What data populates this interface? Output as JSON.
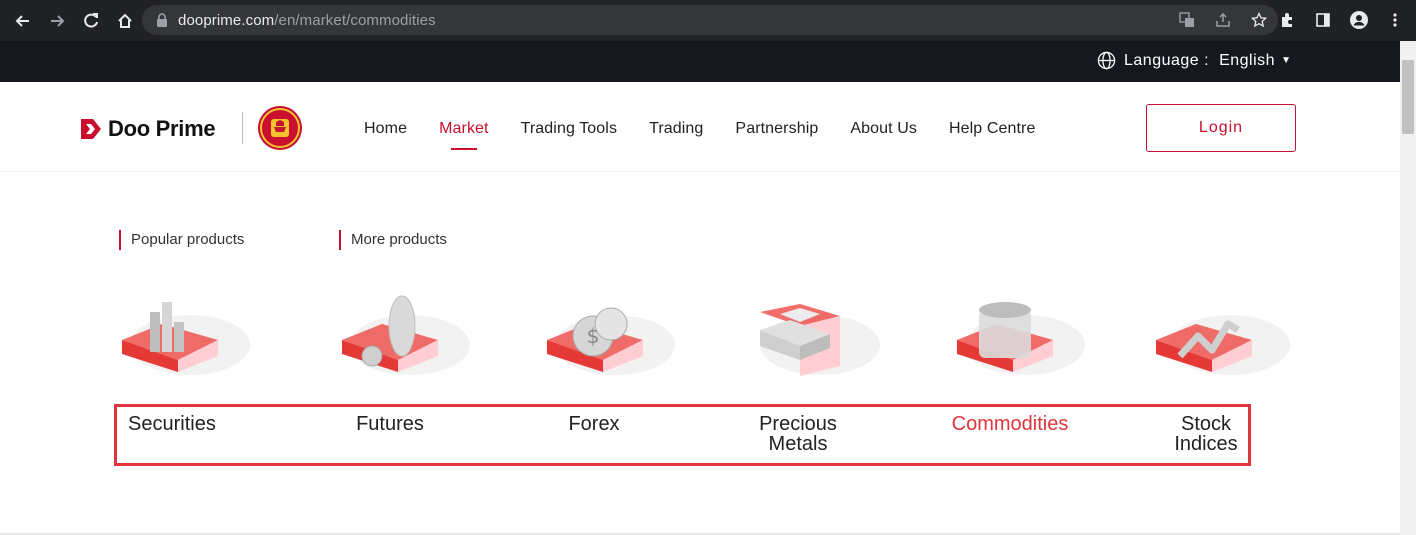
{
  "browser": {
    "url_host": "dooprime.com",
    "url_path": "/en/market/commodities"
  },
  "topbar": {
    "language_label": "Language :",
    "language_value": "English"
  },
  "header": {
    "brand": "Doo Prime",
    "menu": [
      "Home",
      "Market",
      "Trading Tools",
      "Trading",
      "Partnership",
      "About Us",
      "Help Centre"
    ],
    "active_menu": "Market",
    "login_label": "Login"
  },
  "product_tabs": {
    "popular": "Popular products",
    "more": "More products"
  },
  "products": [
    {
      "label": "Securities",
      "icon": "securities-icon"
    },
    {
      "label": "Futures",
      "icon": "futures-icon"
    },
    {
      "label": "Forex",
      "icon": "forex-icon"
    },
    {
      "label_line1": "Precious",
      "label_line2": "Metals",
      "icon": "precious-metals-icon"
    },
    {
      "label": "Commodities",
      "icon": "commodities-icon",
      "active": true
    },
    {
      "label_line1": "Stock",
      "label_line2": "Indices",
      "icon": "stock-indices-icon"
    }
  ],
  "colors": {
    "accent": "#c8102e",
    "highlight_box": "#e0353c",
    "topbar_bg": "#15181f",
    "chrome_bg": "#202124"
  }
}
